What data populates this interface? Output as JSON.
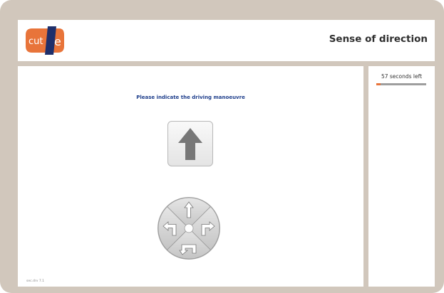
{
  "header": {
    "logo_text": "cut-e",
    "title": "Sense of direction"
  },
  "timer": {
    "label": "57 seconds left",
    "remaining_fraction": 0.08,
    "fill_color": "#e8743a"
  },
  "question": {
    "instruction": "Please indicate the driving manoeuvre",
    "stimulus_icon": "arrow-up-icon"
  },
  "answer_wheel": {
    "options": [
      {
        "name": "straight-ahead",
        "icon": "arrow-up-icon"
      },
      {
        "name": "turn-left",
        "icon": "turn-left-arrow-icon"
      },
      {
        "name": "turn-right",
        "icon": "turn-right-arrow-icon"
      },
      {
        "name": "u-turn",
        "icon": "u-turn-arrow-icon"
      }
    ]
  },
  "footer": {
    "version": "sec.drv 7.1"
  },
  "colors": {
    "frame": "#d1c7bc",
    "instruction_text": "#1f3f8c",
    "logo_orange": "#e8743a",
    "logo_navy": "#1e2f6b"
  }
}
